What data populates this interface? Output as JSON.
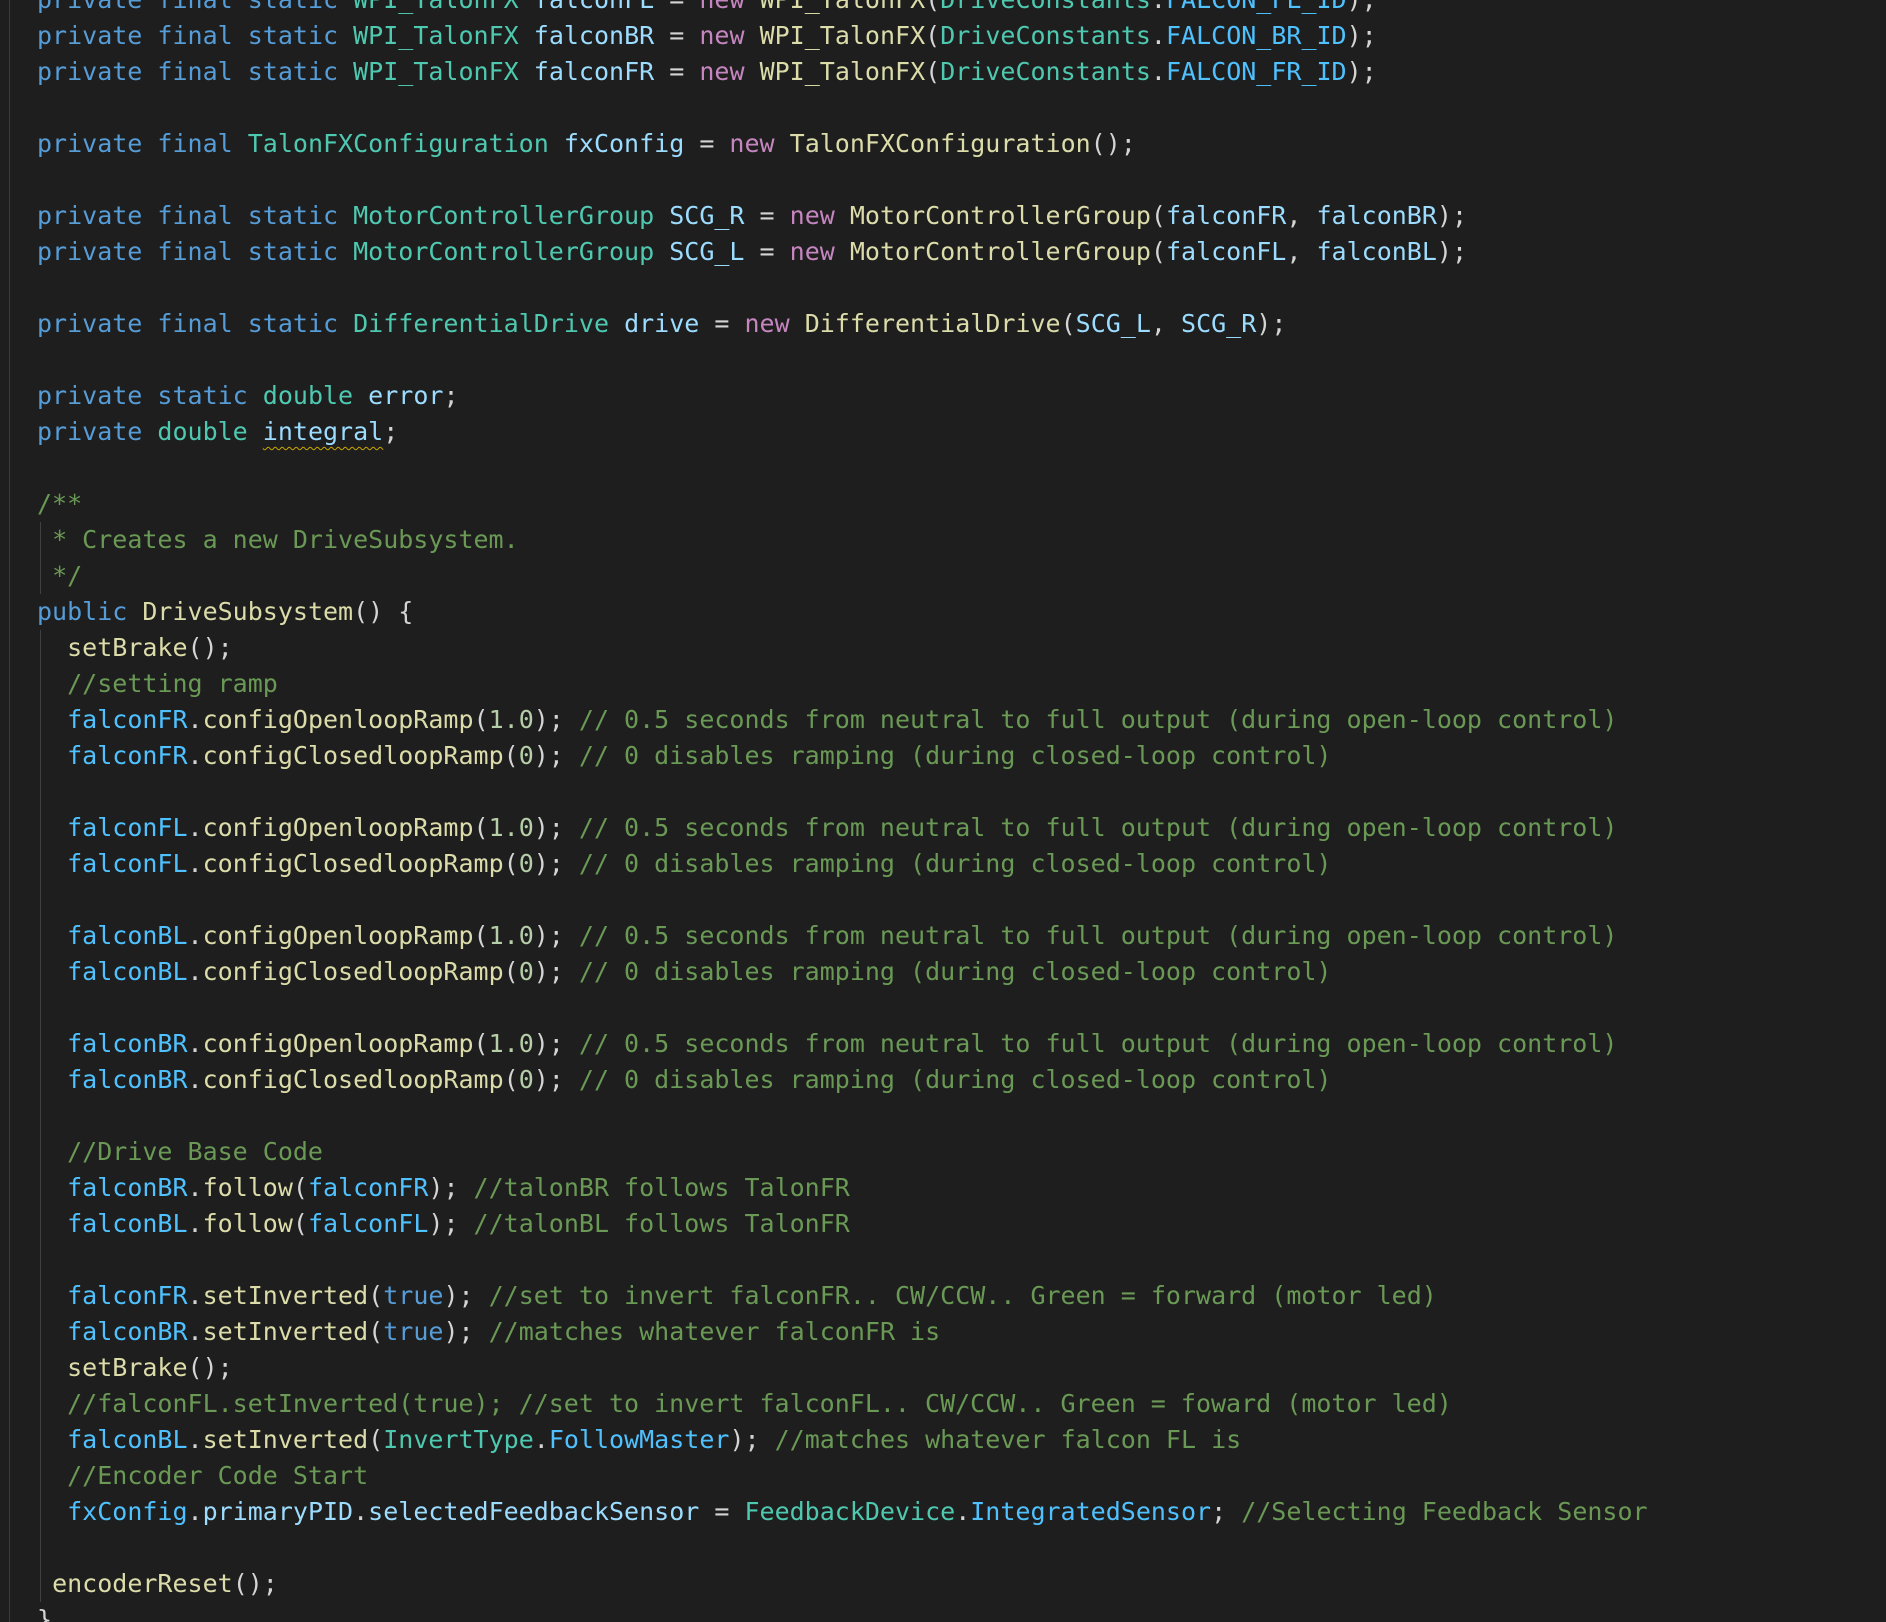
{
  "editor": {
    "language": "java",
    "lines": [
      {
        "tokens": [
          {
            "t": "private",
            "c": "k"
          },
          {
            "t": " "
          },
          {
            "t": "final",
            "c": "k"
          },
          {
            "t": " "
          },
          {
            "t": "static",
            "c": "k"
          },
          {
            "t": " "
          },
          {
            "t": "WPI_TalonFX",
            "c": "t"
          },
          {
            "t": " "
          },
          {
            "t": "falconFL",
            "c": "v"
          },
          {
            "t": " = "
          },
          {
            "t": "new",
            "c": "c"
          },
          {
            "t": " "
          },
          {
            "t": "WPI_TalonFX",
            "c": "f"
          },
          {
            "t": "("
          },
          {
            "t": "DriveConstants",
            "c": "t"
          },
          {
            "t": "."
          },
          {
            "t": "FALCON_FL_ID",
            "c": "b"
          },
          {
            "t": ");"
          }
        ],
        "partial": true
      },
      {
        "tokens": [
          {
            "t": "private",
            "c": "k"
          },
          {
            "t": " "
          },
          {
            "t": "final",
            "c": "k"
          },
          {
            "t": " "
          },
          {
            "t": "static",
            "c": "k"
          },
          {
            "t": " "
          },
          {
            "t": "WPI_TalonFX",
            "c": "t"
          },
          {
            "t": " "
          },
          {
            "t": "falconBR",
            "c": "v"
          },
          {
            "t": " = "
          },
          {
            "t": "new",
            "c": "c"
          },
          {
            "t": " "
          },
          {
            "t": "WPI_TalonFX",
            "c": "f"
          },
          {
            "t": "("
          },
          {
            "t": "DriveConstants",
            "c": "t"
          },
          {
            "t": "."
          },
          {
            "t": "FALCON_BR_ID",
            "c": "b"
          },
          {
            "t": ");"
          }
        ]
      },
      {
        "tokens": [
          {
            "t": "private",
            "c": "k"
          },
          {
            "t": " "
          },
          {
            "t": "final",
            "c": "k"
          },
          {
            "t": " "
          },
          {
            "t": "static",
            "c": "k"
          },
          {
            "t": " "
          },
          {
            "t": "WPI_TalonFX",
            "c": "t"
          },
          {
            "t": " "
          },
          {
            "t": "falconFR",
            "c": "v"
          },
          {
            "t": " = "
          },
          {
            "t": "new",
            "c": "c"
          },
          {
            "t": " "
          },
          {
            "t": "WPI_TalonFX",
            "c": "f"
          },
          {
            "t": "("
          },
          {
            "t": "DriveConstants",
            "c": "t"
          },
          {
            "t": "."
          },
          {
            "t": "FALCON_FR_ID",
            "c": "b"
          },
          {
            "t": ");"
          }
        ]
      },
      {
        "tokens": []
      },
      {
        "tokens": [
          {
            "t": "private",
            "c": "k"
          },
          {
            "t": " "
          },
          {
            "t": "final",
            "c": "k"
          },
          {
            "t": " "
          },
          {
            "t": "TalonFXConfiguration",
            "c": "t"
          },
          {
            "t": " "
          },
          {
            "t": "fxConfig",
            "c": "v"
          },
          {
            "t": " = "
          },
          {
            "t": "new",
            "c": "c"
          },
          {
            "t": " "
          },
          {
            "t": "TalonFXConfiguration",
            "c": "f"
          },
          {
            "t": "();"
          }
        ]
      },
      {
        "tokens": []
      },
      {
        "tokens": [
          {
            "t": "private",
            "c": "k"
          },
          {
            "t": " "
          },
          {
            "t": "final",
            "c": "k"
          },
          {
            "t": " "
          },
          {
            "t": "static",
            "c": "k"
          },
          {
            "t": " "
          },
          {
            "t": "MotorControllerGroup",
            "c": "t"
          },
          {
            "t": " "
          },
          {
            "t": "SCG_R",
            "c": "v"
          },
          {
            "t": " = "
          },
          {
            "t": "new",
            "c": "c"
          },
          {
            "t": " "
          },
          {
            "t": "MotorControllerGroup",
            "c": "f"
          },
          {
            "t": "("
          },
          {
            "t": "falconFR",
            "c": "v"
          },
          {
            "t": ", "
          },
          {
            "t": "falconBR",
            "c": "v"
          },
          {
            "t": ");"
          }
        ]
      },
      {
        "tokens": [
          {
            "t": "private",
            "c": "k"
          },
          {
            "t": " "
          },
          {
            "t": "final",
            "c": "k"
          },
          {
            "t": " "
          },
          {
            "t": "static",
            "c": "k"
          },
          {
            "t": " "
          },
          {
            "t": "MotorControllerGroup",
            "c": "t"
          },
          {
            "t": " "
          },
          {
            "t": "SCG_L",
            "c": "v"
          },
          {
            "t": " = "
          },
          {
            "t": "new",
            "c": "c"
          },
          {
            "t": " "
          },
          {
            "t": "MotorControllerGroup",
            "c": "f"
          },
          {
            "t": "("
          },
          {
            "t": "falconFL",
            "c": "v"
          },
          {
            "t": ", "
          },
          {
            "t": "falconBL",
            "c": "v"
          },
          {
            "t": ");"
          }
        ]
      },
      {
        "tokens": []
      },
      {
        "tokens": [
          {
            "t": "private",
            "c": "k"
          },
          {
            "t": " "
          },
          {
            "t": "final",
            "c": "k"
          },
          {
            "t": " "
          },
          {
            "t": "static",
            "c": "k"
          },
          {
            "t": " "
          },
          {
            "t": "DifferentialDrive",
            "c": "t"
          },
          {
            "t": " "
          },
          {
            "t": "drive",
            "c": "v"
          },
          {
            "t": " = "
          },
          {
            "t": "new",
            "c": "c"
          },
          {
            "t": " "
          },
          {
            "t": "DifferentialDrive",
            "c": "f"
          },
          {
            "t": "("
          },
          {
            "t": "SCG_L",
            "c": "v"
          },
          {
            "t": ", "
          },
          {
            "t": "SCG_R",
            "c": "v"
          },
          {
            "t": ");"
          }
        ]
      },
      {
        "tokens": []
      },
      {
        "tokens": [
          {
            "t": "private",
            "c": "k"
          },
          {
            "t": " "
          },
          {
            "t": "static",
            "c": "k"
          },
          {
            "t": " "
          },
          {
            "t": "double",
            "c": "t"
          },
          {
            "t": " "
          },
          {
            "t": "error",
            "c": "v"
          },
          {
            "t": ";"
          }
        ]
      },
      {
        "tokens": [
          {
            "t": "private",
            "c": "k"
          },
          {
            "t": " "
          },
          {
            "t": "double",
            "c": "t"
          },
          {
            "t": " "
          },
          {
            "t": "integral",
            "c": "v sq"
          },
          {
            "t": ";"
          }
        ]
      },
      {
        "tokens": []
      },
      {
        "tokens": [
          {
            "t": "/**",
            "c": "cm"
          }
        ]
      },
      {
        "indent": 1,
        "tokens": [
          {
            "t": "* Creates a new DriveSubsystem.",
            "c": "cm"
          }
        ]
      },
      {
        "indent": 1,
        "tokens": [
          {
            "t": "*/",
            "c": "cm"
          }
        ]
      },
      {
        "tokens": [
          {
            "t": "public",
            "c": "k"
          },
          {
            "t": " "
          },
          {
            "t": "DriveSubsystem",
            "c": "f"
          },
          {
            "t": "() {"
          }
        ]
      },
      {
        "indent": 2,
        "tokens": [
          {
            "t": "setBrake",
            "c": "f"
          },
          {
            "t": "();"
          }
        ]
      },
      {
        "indent": 2,
        "tokens": [
          {
            "t": "//setting ramp",
            "c": "cm"
          }
        ]
      },
      {
        "indent": 2,
        "tokens": [
          {
            "t": "falconFR",
            "c": "b"
          },
          {
            "t": "."
          },
          {
            "t": "configOpenloopRamp",
            "c": "f"
          },
          {
            "t": "("
          },
          {
            "t": "1.0",
            "c": "n"
          },
          {
            "t": "); "
          },
          {
            "t": "// 0.5 seconds from neutral to full output (during open-loop control)",
            "c": "cm"
          }
        ]
      },
      {
        "indent": 2,
        "tokens": [
          {
            "t": "falconFR",
            "c": "b"
          },
          {
            "t": "."
          },
          {
            "t": "configClosedloopRamp",
            "c": "f"
          },
          {
            "t": "("
          },
          {
            "t": "0",
            "c": "n"
          },
          {
            "t": "); "
          },
          {
            "t": "// 0 disables ramping (during closed-loop control)",
            "c": "cm"
          }
        ]
      },
      {
        "indent": 2,
        "tokens": []
      },
      {
        "indent": 2,
        "tokens": [
          {
            "t": "falconFL",
            "c": "b"
          },
          {
            "t": "."
          },
          {
            "t": "configOpenloopRamp",
            "c": "f"
          },
          {
            "t": "("
          },
          {
            "t": "1.0",
            "c": "n"
          },
          {
            "t": "); "
          },
          {
            "t": "// 0.5 seconds from neutral to full output (during open-loop control)",
            "c": "cm"
          }
        ]
      },
      {
        "indent": 2,
        "tokens": [
          {
            "t": "falconFL",
            "c": "b"
          },
          {
            "t": "."
          },
          {
            "t": "configClosedloopRamp",
            "c": "f"
          },
          {
            "t": "("
          },
          {
            "t": "0",
            "c": "n"
          },
          {
            "t": "); "
          },
          {
            "t": "// 0 disables ramping (during closed-loop control)",
            "c": "cm"
          }
        ]
      },
      {
        "indent": 2,
        "tokens": []
      },
      {
        "indent": 2,
        "tokens": [
          {
            "t": "falconBL",
            "c": "b"
          },
          {
            "t": "."
          },
          {
            "t": "configOpenloopRamp",
            "c": "f"
          },
          {
            "t": "("
          },
          {
            "t": "1.0",
            "c": "n"
          },
          {
            "t": "); "
          },
          {
            "t": "// 0.5 seconds from neutral to full output (during open-loop control)",
            "c": "cm"
          }
        ]
      },
      {
        "indent": 2,
        "tokens": [
          {
            "t": "falconBL",
            "c": "b"
          },
          {
            "t": "."
          },
          {
            "t": "configClosedloopRamp",
            "c": "f"
          },
          {
            "t": "("
          },
          {
            "t": "0",
            "c": "n"
          },
          {
            "t": "); "
          },
          {
            "t": "// 0 disables ramping (during closed-loop control)",
            "c": "cm"
          }
        ]
      },
      {
        "indent": 2,
        "tokens": []
      },
      {
        "indent": 2,
        "tokens": [
          {
            "t": "falconBR",
            "c": "b"
          },
          {
            "t": "."
          },
          {
            "t": "configOpenloopRamp",
            "c": "f"
          },
          {
            "t": "("
          },
          {
            "t": "1.0",
            "c": "n"
          },
          {
            "t": "); "
          },
          {
            "t": "// 0.5 seconds from neutral to full output (during open-loop control)",
            "c": "cm"
          }
        ]
      },
      {
        "indent": 2,
        "tokens": [
          {
            "t": "falconBR",
            "c": "b"
          },
          {
            "t": "."
          },
          {
            "t": "configClosedloopRamp",
            "c": "f"
          },
          {
            "t": "("
          },
          {
            "t": "0",
            "c": "n"
          },
          {
            "t": "); "
          },
          {
            "t": "// 0 disables ramping (during closed-loop control)",
            "c": "cm"
          }
        ]
      },
      {
        "indent": 2,
        "tokens": []
      },
      {
        "indent": 2,
        "tokens": [
          {
            "t": "//Drive Base Code",
            "c": "cm"
          }
        ]
      },
      {
        "indent": 2,
        "tokens": [
          {
            "t": "falconBR",
            "c": "b"
          },
          {
            "t": "."
          },
          {
            "t": "follow",
            "c": "f"
          },
          {
            "t": "("
          },
          {
            "t": "falconFR",
            "c": "b"
          },
          {
            "t": "); "
          },
          {
            "t": "//talonBR follows TalonFR",
            "c": "cm"
          }
        ]
      },
      {
        "indent": 2,
        "tokens": [
          {
            "t": "falconBL",
            "c": "b"
          },
          {
            "t": "."
          },
          {
            "t": "follow",
            "c": "f"
          },
          {
            "t": "("
          },
          {
            "t": "falconFL",
            "c": "b"
          },
          {
            "t": "); "
          },
          {
            "t": "//talonBL follows TalonFR",
            "c": "cm"
          }
        ]
      },
      {
        "indent": 2,
        "tokens": []
      },
      {
        "indent": 2,
        "tokens": [
          {
            "t": "falconFR",
            "c": "b"
          },
          {
            "t": "."
          },
          {
            "t": "setInverted",
            "c": "f"
          },
          {
            "t": "("
          },
          {
            "t": "true",
            "c": "k"
          },
          {
            "t": "); "
          },
          {
            "t": "//set to invert falconFR.. CW/CCW.. Green = forward (motor led)",
            "c": "cm"
          }
        ]
      },
      {
        "indent": 2,
        "tokens": [
          {
            "t": "falconBR",
            "c": "b"
          },
          {
            "t": "."
          },
          {
            "t": "setInverted",
            "c": "f"
          },
          {
            "t": "("
          },
          {
            "t": "true",
            "c": "k"
          },
          {
            "t": "); "
          },
          {
            "t": "//matches whatever falconFR is",
            "c": "cm"
          }
        ]
      },
      {
        "indent": 2,
        "tokens": [
          {
            "t": "setBrake",
            "c": "f"
          },
          {
            "t": "();"
          }
        ]
      },
      {
        "indent": 2,
        "tokens": [
          {
            "t": "//falconFL.setInverted(true); //set to invert falconFL.. CW/CCW.. Green = foward (motor led)",
            "c": "cm"
          }
        ]
      },
      {
        "indent": 2,
        "tokens": [
          {
            "t": "falconBL",
            "c": "b"
          },
          {
            "t": "."
          },
          {
            "t": "setInverted",
            "c": "f"
          },
          {
            "t": "("
          },
          {
            "t": "InvertType",
            "c": "t"
          },
          {
            "t": "."
          },
          {
            "t": "FollowMaster",
            "c": "b"
          },
          {
            "t": "); "
          },
          {
            "t": "//matches whatever falcon FL is",
            "c": "cm"
          }
        ]
      },
      {
        "indent": 2,
        "tokens": [
          {
            "t": "//Encoder Code Start",
            "c": "cm"
          }
        ]
      },
      {
        "indent": 2,
        "tokens": [
          {
            "t": "fxConfig",
            "c": "b"
          },
          {
            "t": "."
          },
          {
            "t": "primaryPID",
            "c": "v"
          },
          {
            "t": "."
          },
          {
            "t": "selectedFeedbackSensor",
            "c": "v"
          },
          {
            "t": " = "
          },
          {
            "t": "FeedbackDevice",
            "c": "t"
          },
          {
            "t": "."
          },
          {
            "t": "IntegratedSensor",
            "c": "b"
          },
          {
            "t": "; "
          },
          {
            "t": "//Selecting Feedback Sensor",
            "c": "cm"
          }
        ]
      },
      {
        "indent": 2,
        "tokens": []
      },
      {
        "indent": 1,
        "tokens": [
          {
            "t": "encoderReset",
            "c": "f"
          },
          {
            "t": "();"
          }
        ]
      },
      {
        "tokens": [
          {
            "t": "}"
          }
        ]
      }
    ]
  }
}
